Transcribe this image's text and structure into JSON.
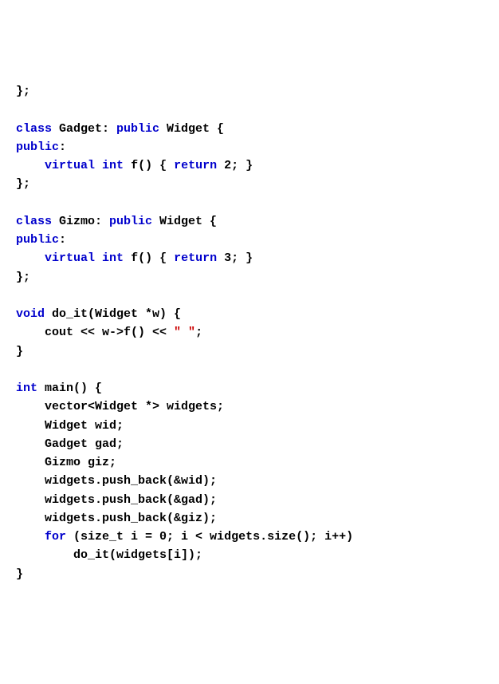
{
  "code": {
    "l1_a": "};",
    "l2_blank": "",
    "l3_a": "class",
    "l3_b": " Gadget: ",
    "l3_c": "public",
    "l3_d": " Widget {",
    "l4_a": "public",
    "l4_b": ":",
    "l5_a": "    ",
    "l5_b": "virtual",
    "l5_c": " ",
    "l5_d": "int",
    "l5_e": " f() { ",
    "l5_f": "return",
    "l5_g": " 2; }",
    "l6_a": "};",
    "l7_blank": "",
    "l8_a": "class",
    "l8_b": " Gizmo: ",
    "l8_c": "public",
    "l8_d": " Widget {",
    "l9_a": "public",
    "l9_b": ":",
    "l10_a": "    ",
    "l10_b": "virtual",
    "l10_c": " ",
    "l10_d": "int",
    "l10_e": " f() { ",
    "l10_f": "return",
    "l10_g": " 3; }",
    "l11_a": "};",
    "l12_blank": "",
    "l13_a": "void",
    "l13_b": " do_it(Widget *w) {",
    "l14_a": "    cout << w->f() << ",
    "l14_b": "\" \"",
    "l14_c": ";",
    "l15_a": "}",
    "l16_blank": "",
    "l17_a": "int",
    "l17_b": " main() {",
    "l18_a": "    vector<Widget *> widgets;",
    "l19_a": "    Widget wid;",
    "l20_a": "    Gadget gad;",
    "l21_a": "    Gizmo giz;",
    "l22_a": "    widgets.push_back(&wid);",
    "l23_a": "    widgets.push_back(&gad);",
    "l24_a": "    widgets.push_back(&giz);",
    "l25_a": "    ",
    "l25_b": "for",
    "l25_c": " (size_t i = 0; i < widgets.size(); i++)",
    "l26_a": "        do_it(widgets[i]);",
    "l27_a": "}"
  }
}
